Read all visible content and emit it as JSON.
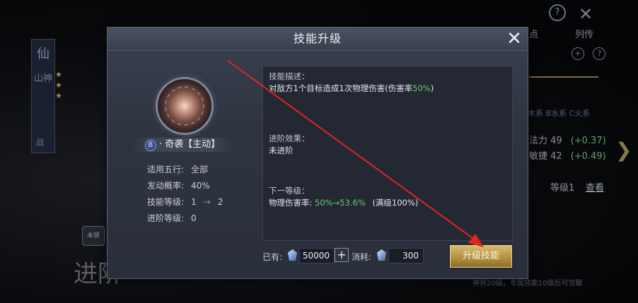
{
  "background": {
    "side_char": "仙",
    "side_name": "山神",
    "battle_label": "战",
    "locked_label": "未锁",
    "jinjie_label": "进阶",
    "top_help": "?",
    "top_close": "✕",
    "tab_dian": "点",
    "tab_liezhuan": "列传",
    "row_plus": "+",
    "row_help": "?",
    "tags": "木系  B水系  C火系",
    "stat1_label": "法力 49",
    "stat1_delta": "(+0.37)",
    "stat2_label": "敏捷 42",
    "stat2_delta": "(+0.49)",
    "level_label": "等级1",
    "view_label": "查看",
    "footer_hint": "神将20级，专属技能10级后可觉醒"
  },
  "dialog": {
    "title": "技能升级",
    "close_icon": "close-x-icon",
    "skill": {
      "grade": "B",
      "name": "· 奇袭【主动】"
    },
    "stats": [
      {
        "label": "适用五行:",
        "value": "全部"
      },
      {
        "label": "发动概率:",
        "value": "40%"
      },
      {
        "label": "技能等级:",
        "from": "1",
        "arrow": "→",
        "to": "2"
      },
      {
        "label": "进阶等级:",
        "value": "0"
      }
    ],
    "description": {
      "head": "技能描述：",
      "text_prefix": "对敌方1个目标造成1次物理伤害(伤害率",
      "text_value": "50%",
      "text_suffix": ")"
    },
    "advance": {
      "head": "进阶效果：",
      "text": "未进阶"
    },
    "next_level": {
      "head": "下一等级：",
      "label": "物理伤害率:",
      "from": "50%",
      "arrow": "→",
      "to": "53.6%",
      "max": "(满级100%)"
    },
    "owned_label": "已有:",
    "owned_value": "50000",
    "cost_label": "消耗:",
    "cost_value": "300",
    "upgrade_label": "升级技能"
  },
  "colors": {
    "highlight_green": "#5fcf6a",
    "button_gold": "#c9a757",
    "annotation_red": "#e0261f"
  }
}
